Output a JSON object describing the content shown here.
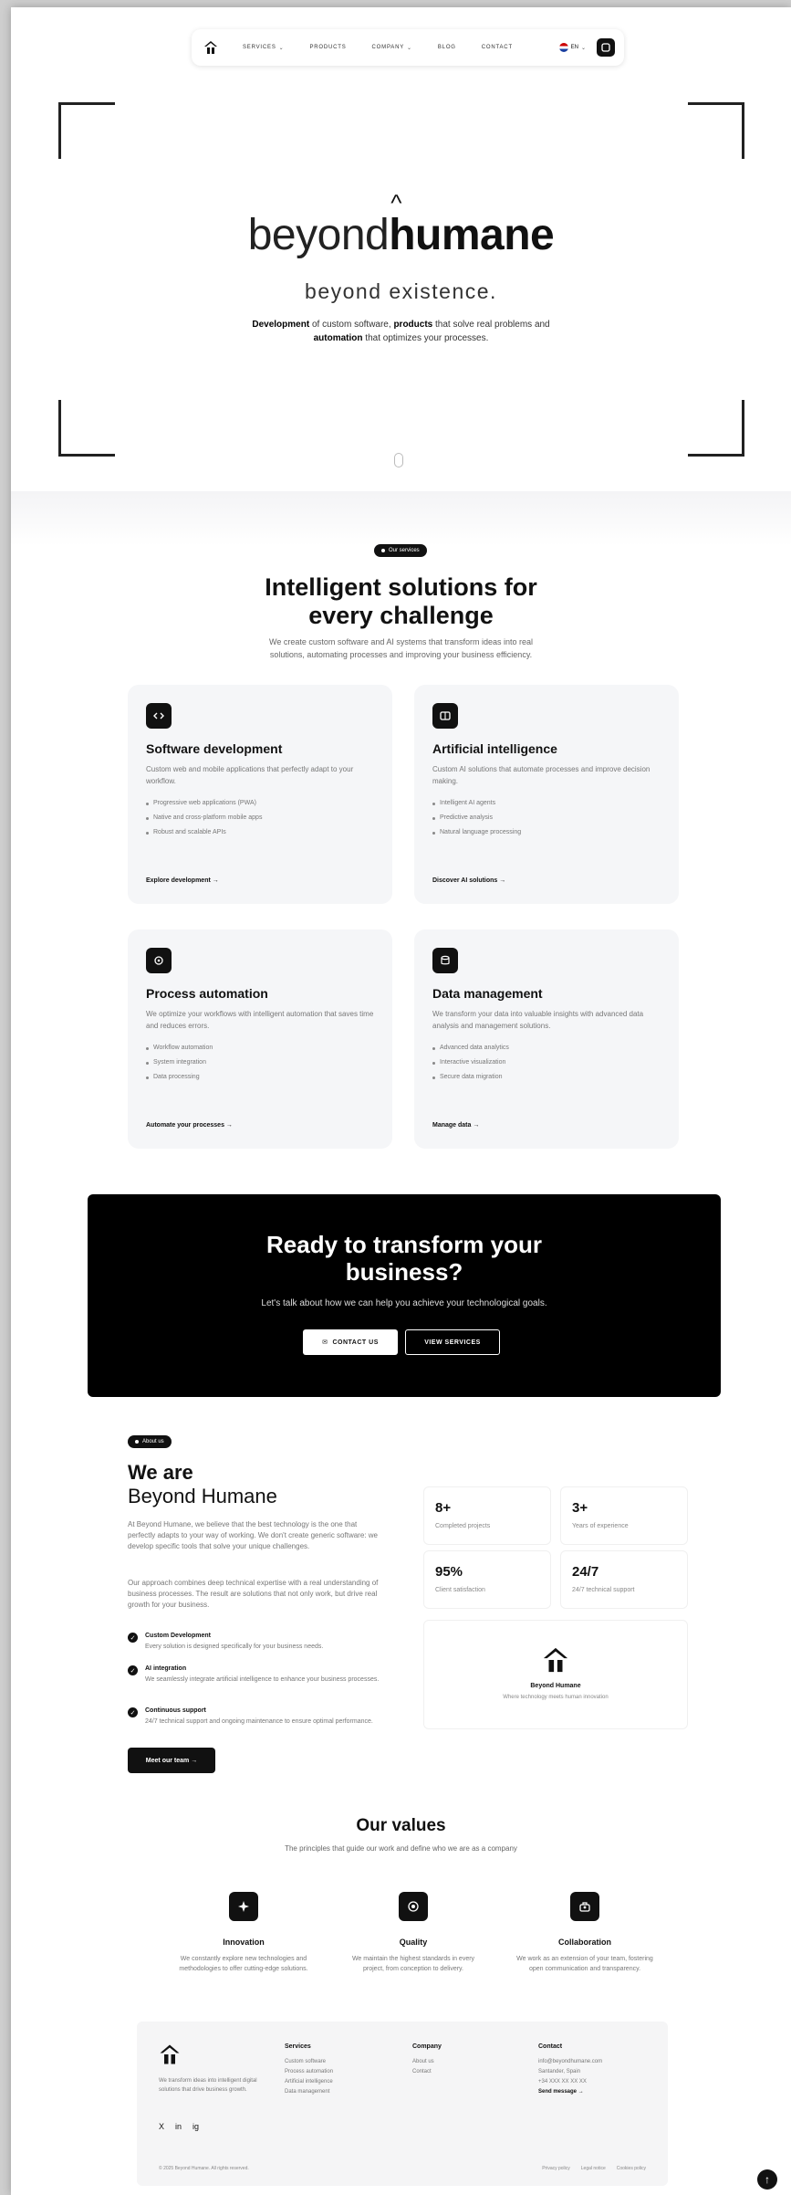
{
  "nav": {
    "items": [
      {
        "label": "SERVICES",
        "chevron": true
      },
      {
        "label": "PRODUCTS",
        "chevron": false
      },
      {
        "label": "COMPANY",
        "chevron": true
      },
      {
        "label": "BLOG",
        "chevron": false
      },
      {
        "label": "CONTACT",
        "chevron": false
      }
    ],
    "lang": "EN",
    "logo_icon": "house-logo-icon",
    "menu_icon": "app-icon"
  },
  "hero": {
    "brand_part1": "beyond",
    "brand_part2": "humane",
    "tagline": "beyond existence.",
    "desc_b1": "Development",
    "desc_t1": " of custom software, ",
    "desc_b2": "products",
    "desc_t2": " that solve real problems and ",
    "desc_b3": "automation",
    "desc_t3": " that optimizes your processes."
  },
  "services": {
    "pill": "Our services",
    "title_line1": "Intelligent solutions for",
    "title_line2": "every challenge",
    "subtitle_line1": "We create custom software and AI systems that transform ideas into real",
    "subtitle_line2": "solutions, automating processes and improving your business efficiency.",
    "cards": [
      {
        "icon": "code-icon",
        "title": "Software development",
        "desc": "Custom web and mobile applications that perfectly adapt to your workflow.",
        "items": [
          "Progressive web applications (PWA)",
          "Native and cross-platform mobile apps",
          "Robust and scalable APIs"
        ],
        "link": "Explore development →"
      },
      {
        "icon": "chip-icon",
        "title": "Artificial intelligence",
        "desc": "Custom AI solutions that automate processes and improve decision making.",
        "items": [
          "Intelligent AI agents",
          "Predictive analysis",
          "Natural language processing"
        ],
        "link": "Discover AI solutions →"
      },
      {
        "icon": "gear-icon",
        "title": "Process automation",
        "desc": "We optimize your workflows with intelligent automation that saves time and reduces errors.",
        "items": [
          "Workflow automation",
          "System integration",
          "Data processing"
        ],
        "link": "Automate your processes →"
      },
      {
        "icon": "database-icon",
        "title": "Data management",
        "desc": "We transform your data into valuable insights with advanced data analysis and management solutions.",
        "items": [
          "Advanced data analytics",
          "Interactive visualization",
          "Secure data migration"
        ],
        "link": "Manage data →"
      }
    ]
  },
  "cta": {
    "title_line1": "Ready to transform your",
    "title_line2": "business?",
    "subtitle": "Let's talk about how we can help you achieve your technological goals.",
    "contact_btn": "CONTACT US",
    "services_btn": "VIEW SERVICES"
  },
  "about": {
    "pill": "About us",
    "title_line1": "We are",
    "title_line2": "Beyond Humane",
    "p1": "At Beyond Humane, we believe that the best technology is the one that perfectly adapts to your way of working. We don't create generic software: we develop specific tools that solve your unique challenges.",
    "p2": "Our approach combines deep technical expertise with a real understanding of business processes. The result are solutions that not only work, but drive real growth for your business.",
    "features": [
      {
        "title": "Custom Development",
        "desc": "Every solution is designed specifically for your business needs."
      },
      {
        "title": "AI integration",
        "desc": "We seamlessly integrate artificial intelligence to enhance your business processes."
      },
      {
        "title": "Continuous support",
        "desc": "24/7 technical support and ongoing maintenance to ensure optimal performance."
      }
    ],
    "team_btn": "Meet our team →",
    "stats": [
      {
        "value": "8+",
        "label": "Completed projects"
      },
      {
        "value": "3+",
        "label": "Years of experience"
      },
      {
        "value": "95%",
        "label": "Client satisfaction"
      },
      {
        "value": "24/7",
        "label": "24/7 technical support"
      }
    ],
    "logo_name": "Beyond Humane",
    "logo_tag": "Where technology meets human innovation"
  },
  "values": {
    "title": "Our values",
    "subtitle": "The principles that guide our work and define who we are as a company",
    "items": [
      {
        "icon": "sparkle-icon",
        "title": "Innovation",
        "desc": "We constantly explore new technologies and methodologies to offer cutting-edge solutions."
      },
      {
        "icon": "target-icon",
        "title": "Quality",
        "desc": "We maintain the highest standards in every project, from conception to delivery."
      },
      {
        "icon": "team-icon",
        "title": "Collaboration",
        "desc": "We work as an extension of your team, fostering open communication and transparency."
      }
    ]
  },
  "footer": {
    "desc": "We transform ideas into intelligent digital solutions that drive business growth.",
    "social": [
      "X",
      "in",
      "ig"
    ],
    "cols": [
      {
        "heading": "Services",
        "items": [
          "Custom software",
          "Process automation",
          "Artificial intelligence",
          "Data management"
        ]
      },
      {
        "heading": "Company",
        "items": [
          "About us",
          "Contact"
        ]
      },
      {
        "heading": "Contact",
        "items": [
          "info@beyondhumane.com",
          "Santander, Spain",
          "+34 XXX XX XX XX"
        ]
      }
    ],
    "send_message": "Send message →",
    "copyright": "© 2025 Beyond Humane. All rights reserved.",
    "legal": [
      "Privacy policy",
      "Legal notice",
      "Cookies policy"
    ]
  },
  "colors": {
    "primary": "#111111",
    "card_bg": "#f5f6f8",
    "muted": "#777777"
  }
}
